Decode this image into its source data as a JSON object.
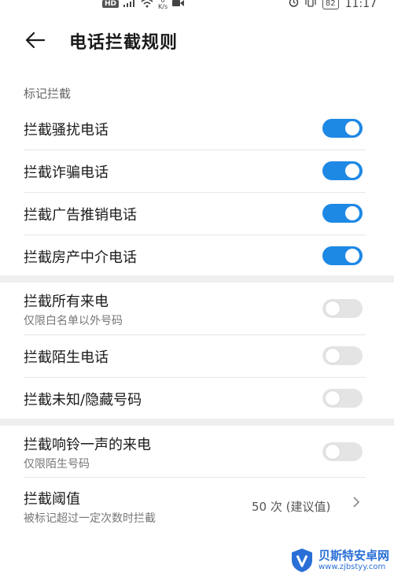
{
  "status_bar": {
    "hd": "HD",
    "speed_top": "0",
    "speed_unit": "K/s",
    "battery": "82",
    "time": "11:17"
  },
  "header": {
    "title": "电话拦截规则"
  },
  "section": {
    "label": "标记拦截"
  },
  "rows": [
    {
      "label": "拦截骚扰电话",
      "on": true
    },
    {
      "label": "拦截诈骗电话",
      "on": true
    },
    {
      "label": "拦截广告推销电话",
      "on": true
    },
    {
      "label": "拦截房产中介电话",
      "on": true
    },
    {
      "label": "拦截所有来电",
      "sub": "仅限白名单以外号码",
      "on": false
    },
    {
      "label": "拦截陌生电话",
      "on": false
    },
    {
      "label": "拦截未知/隐藏号码",
      "on": false
    },
    {
      "label": "拦截响铃一声的来电",
      "sub": "仅限陌生号码",
      "on": false
    }
  ],
  "threshold": {
    "label": "拦截阈值",
    "sub": "被标记超过一定次数时拦截",
    "value": "50 次 (建议值)"
  },
  "watermark": {
    "title": "贝斯特安卓网",
    "url": "www.zjbstyy.com"
  },
  "colors": {
    "accent": "#1e88e5",
    "off": "#e4e4e4",
    "section_gap": "#efefef"
  },
  "icons": {
    "back": "arrow-left-icon",
    "chevron": "chevron-right-icon"
  }
}
